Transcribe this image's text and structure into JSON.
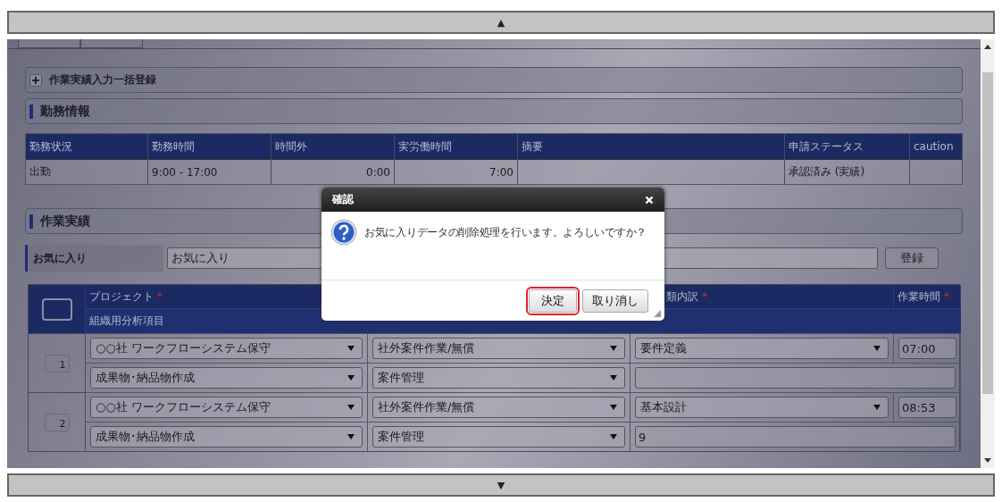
{
  "scroll_up": "▲",
  "scroll_down": "▼",
  "bulk_panel": {
    "title": "作業実績入力一括登録",
    "expanded": false
  },
  "attendance": {
    "title": "勤務情報",
    "columns": [
      "勤務状況",
      "勤務時間",
      "時間外",
      "実労働時間",
      "摘要",
      "申請ステータス",
      "caution"
    ],
    "rows": [
      [
        "出勤",
        "9:00 - 17:00",
        "0:00",
        "7:00",
        "",
        "承認済み (実績)",
        ""
      ]
    ]
  },
  "work": {
    "title": "作業実績",
    "favorite": {
      "label": "お気に入り",
      "value": "お気に入り",
      "button": "登録"
    },
    "header": {
      "select_all": {
        "checked": false
      },
      "columns": [
        {
          "label": "プロジェクト",
          "mark": "*"
        },
        {},
        {
          "label": "類内訳",
          "mark": "*"
        },
        {
          "label": "作業時間",
          "mark": "*"
        }
      ],
      "analysis": "組織用分析項目"
    },
    "rows": [
      {
        "number": "1",
        "line1": [
          {
            "kind": "select",
            "value": "○○社 ワークフローシステム保守"
          },
          {
            "kind": "select",
            "value": "社外案件作業/無償"
          },
          {
            "kind": "select",
            "value": "要件定義"
          },
          {
            "kind": "input",
            "value": "07:00"
          }
        ],
        "line2": [
          {
            "kind": "select",
            "value": "成果物･納品物作成"
          },
          {
            "kind": "select",
            "value": "案件管理"
          },
          {
            "kind": "input"
          }
        ]
      },
      {
        "number": "2",
        "line1": [
          {
            "kind": "select",
            "value": "○○社 ワークフローシステム保守"
          },
          {
            "kind": "select",
            "value": "社外案件作業/無償"
          },
          {
            "kind": "select",
            "value": "基本設計"
          },
          {
            "kind": "input",
            "value": "08:53"
          }
        ],
        "line2": [
          {
            "kind": "select",
            "value": "成果物･納品物作成"
          },
          {
            "kind": "select",
            "value": "案件管理"
          },
          {
            "kind": "input",
            "value": "9"
          }
        ]
      }
    ]
  },
  "dialog": {
    "title": "確認",
    "message": "お気に入りデータの削除処理を行います。よろしいですか？",
    "buttons": [
      {
        "label": "決定",
        "focused": true
      },
      {
        "label": "取り消し",
        "focused": false
      }
    ]
  }
}
